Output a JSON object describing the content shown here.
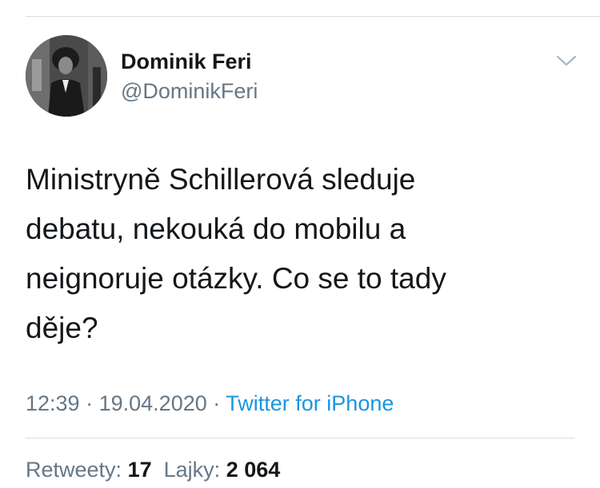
{
  "author": {
    "name": "Dominik Feri",
    "handle": "@DominikFeri",
    "avatar_icon": "profile-photo"
  },
  "tweet": {
    "text": "Ministryně Schillerová sleduje\ndebatu, nekouká do mobilu a\nneignoruje otázky. Co se to tady\nděje?",
    "time": "12:39",
    "separator": "·",
    "date": "19.04.2020",
    "source": "Twitter for iPhone"
  },
  "stats": {
    "retweets_label": "Retweety:",
    "retweets_count": "17",
    "likes_label": "Lajky:",
    "likes_count": "2 064"
  },
  "icons": {
    "menu": "chevron-down-icon"
  },
  "colors": {
    "text": "#14171a",
    "secondary": "#657786",
    "link": "#1b95e0",
    "divider": "#d9dde1"
  }
}
